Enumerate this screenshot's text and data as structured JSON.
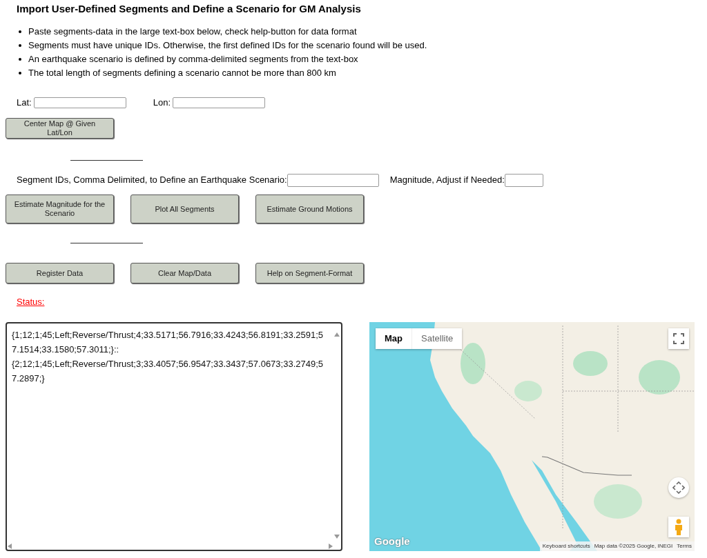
{
  "title": "Import User-Defined Segments and Define a Scenario for GM Analysis",
  "notes": [
    "Paste segments-data in the large text-box below, check help-button for data format",
    "Segments must have unique IDs. Otherwise, the first defined IDs for the scenario found will be used.",
    "An earthquake scenario is defined by comma-delimited segments from the text-box",
    "The total length of segments defining a scenario cannot be more than 800 km"
  ],
  "coordinates": [
    {
      "label": "Lat:"
    },
    {
      "label": "Lon:"
    }
  ],
  "center_button": "Center Map @ Given Lat/Lon",
  "scenario": {
    "label": "Segment IDs, Comma Delimited, to Define an Earthquake Scenario:",
    "magnitude_label": "Magnitude, Adjust if Needed:"
  },
  "scenario_buttons": [
    "Estimate Magnitude for the Scenario",
    "Plot All Segments",
    "Estimate Ground Motions"
  ],
  "data_buttons": [
    "Register Data",
    "Clear Map/Data",
    "Help on Segment-Format"
  ],
  "status": "Status:",
  "segments_text": "{1;12;1;45;Left;Reverse/Thrust;4;33.5171;56.7916;33.4243;56.8191;33.2591;57.1514;33.1580;57.3011;}::\n{2;12;1;45;Left;Reverse/Thrust;3;33.4057;56.9547;33.3437;57.0673;33.2749;57.2897;}",
  "map": {
    "types": [
      {
        "label": "Map",
        "selected": true
      },
      {
        "label": "Satellite",
        "selected": false
      }
    ],
    "logo": "Google",
    "attribution": [
      "Keyboard shortcuts",
      "Map data ©2025 Google, INEGI",
      "Terms"
    ]
  }
}
